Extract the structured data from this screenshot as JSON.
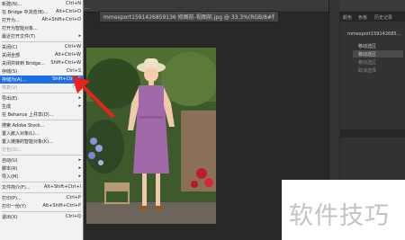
{
  "document": {
    "tab_title": "mmexport1591426859136 修图前-视图前.jpg @ 33.3%(RGB/8#)",
    "close_glyph": "×"
  },
  "top_hint": "设...",
  "file_menu": {
    "items": [
      {
        "label": "新建(N)...",
        "shortcut": "Ctrl+N",
        "dim": false
      },
      {
        "label": "在 Bridge 中浏览(B)...",
        "shortcut": "Alt+Ctrl+O",
        "dim": false
      },
      {
        "label": "打开为...",
        "shortcut": "Alt+Shift+Ctrl+O",
        "dim": false
      },
      {
        "label": "打开为智能对象...",
        "shortcut": "",
        "dim": false
      },
      {
        "label": "最近打开文件(T)",
        "shortcut": "▸",
        "dim": false
      },
      {
        "label": "关闭(C)",
        "shortcut": "Ctrl+W",
        "dim": false
      },
      {
        "label": "关闭全部",
        "shortcut": "Alt+Ctrl+W",
        "dim": false
      },
      {
        "label": "关闭并转到 Bridge...",
        "shortcut": "Shift+Ctrl+W",
        "dim": false
      },
      {
        "label": "存储(S)",
        "shortcut": "Ctrl+S",
        "dim": false
      },
      {
        "label": "存储为(A)...",
        "shortcut": "Shift+Ctrl+S",
        "dim": false,
        "highlight": true
      },
      {
        "label": "恢复(V)",
        "shortcut": "F12",
        "dim": true
      },
      {
        "label": "导出(E)",
        "shortcut": "▸",
        "dim": false
      },
      {
        "label": "生成",
        "shortcut": "▸",
        "dim": false
      },
      {
        "label": "在 Behance 上共享(D)...",
        "shortcut": "",
        "dim": false
      },
      {
        "label": "搜索 Adobe Stock...",
        "shortcut": "",
        "dim": false
      },
      {
        "label": "置入嵌入对象(L)...",
        "shortcut": "",
        "dim": false
      },
      {
        "label": "置入链接的智能对象(K)...",
        "shortcut": "",
        "dim": false
      },
      {
        "label": "打包(G)...",
        "shortcut": "",
        "dim": true
      },
      {
        "label": "自动(U)",
        "shortcut": "▸",
        "dim": false
      },
      {
        "label": "脚本(R)",
        "shortcut": "▸",
        "dim": false
      },
      {
        "label": "导入(M)",
        "shortcut": "▸",
        "dim": false
      },
      {
        "label": "文件简介(F)...",
        "shortcut": "Alt+Shift+Ctrl+I",
        "dim": false
      },
      {
        "label": "打印(P)...",
        "shortcut": "Ctrl+P",
        "dim": false
      },
      {
        "label": "打印一份(Y)",
        "shortcut": "Alt+Shift+Ctrl+P",
        "dim": false
      },
      {
        "label": "退出(X)",
        "shortcut": "Ctrl+Q",
        "dim": false
      }
    ]
  },
  "right_panel": {
    "tabs": [
      "颜色",
      "色板",
      "历史记录"
    ],
    "snapshot_title": "mmexport159142685...",
    "history_items": [
      "移动选区",
      "移动选区",
      "移动选区",
      "取消选择"
    ]
  },
  "watermark_text": "软件技巧",
  "colors": {
    "menu_highlight": "#1f6fe0",
    "arrow": "#e8231c",
    "dress": "#a06aa8"
  }
}
